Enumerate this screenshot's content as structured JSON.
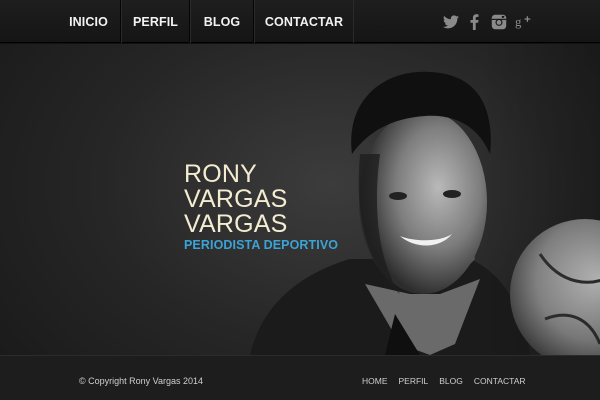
{
  "nav": {
    "items": [
      {
        "label": "INICIO"
      },
      {
        "label": "PERFIL"
      },
      {
        "label": "BLOG"
      },
      {
        "label": "CONTACTAR"
      }
    ]
  },
  "social": {
    "icons": [
      "twitter-icon",
      "facebook-icon",
      "instagram-icon",
      "google-plus-icon"
    ],
    "color": "#8a8a8a"
  },
  "hero": {
    "name_lines": [
      "RONY",
      "VARGAS",
      "VARGAS"
    ],
    "subtitle": "PERIODISTA DEPORTIVO",
    "name_color": "#f3ecd0",
    "subtitle_color": "#3ba3d6"
  },
  "footer": {
    "copyright": "© Copyright Rony Vargas 2014",
    "links": [
      {
        "label": "HOME"
      },
      {
        "label": "PERFIL"
      },
      {
        "label": "BLOG"
      },
      {
        "label": "CONTACTAR"
      }
    ]
  }
}
